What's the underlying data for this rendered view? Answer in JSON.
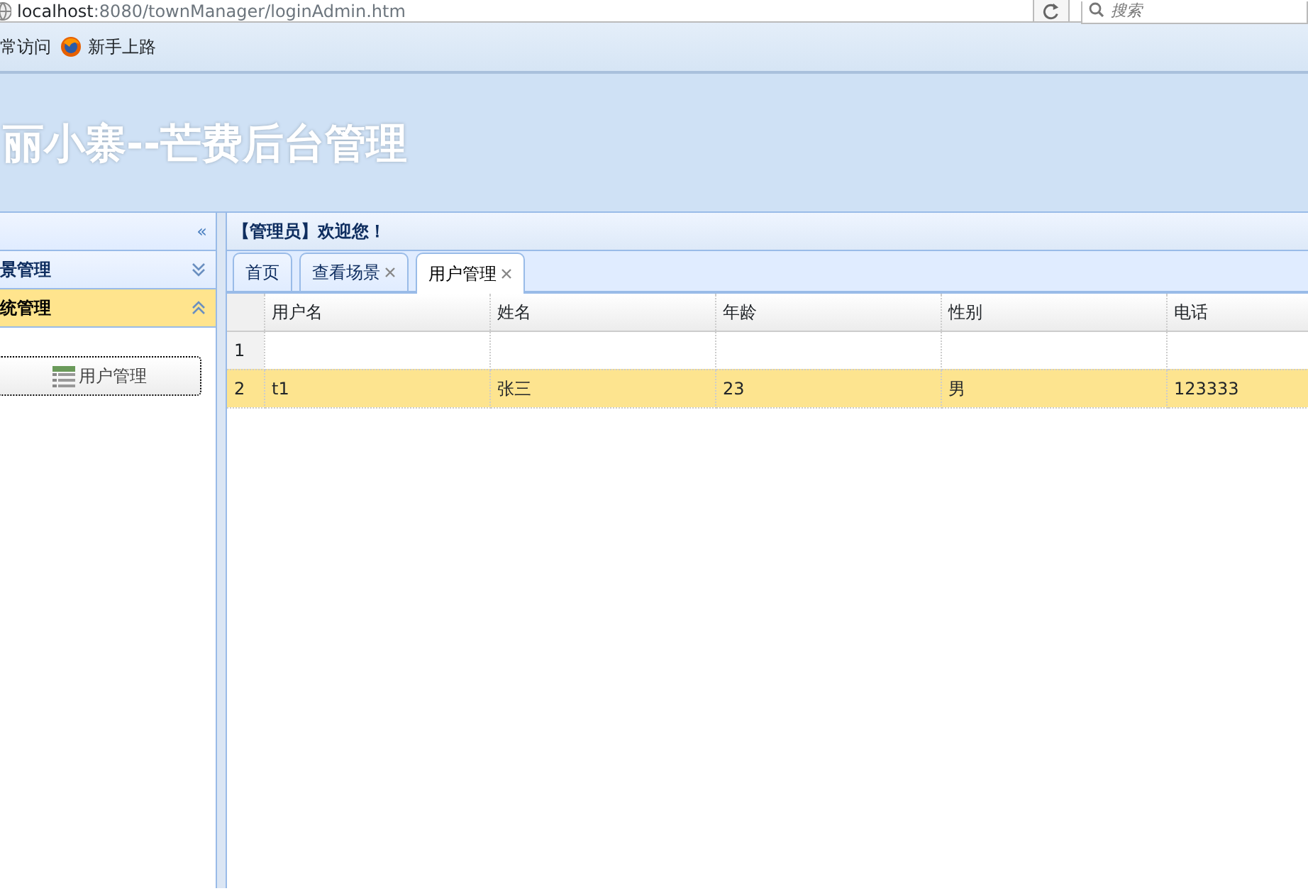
{
  "browser": {
    "url_host": "localhost",
    "url_rest": ":8080/townManager/loginAdmin.htm",
    "search_placeholder": "搜索"
  },
  "bookmarks": [
    {
      "label": "常访问",
      "kind": "plain"
    },
    {
      "label": "新手上路",
      "kind": "firefox"
    }
  ],
  "header": {
    "title": "丽小寨--芒费后台管理"
  },
  "sidebar": {
    "collapse_glyph": "«",
    "sections": [
      {
        "label": "景管理",
        "expanded": false,
        "selected": false
      },
      {
        "label": "统管理",
        "expanded": true,
        "selected": true,
        "items": [
          {
            "label": "用户管理",
            "focused": true
          }
        ]
      }
    ]
  },
  "welcome": "【管理员】欢迎您！",
  "tabs": [
    {
      "label": "首页",
      "closable": false,
      "selected": false
    },
    {
      "label": "查看场景",
      "closable": true,
      "selected": false
    },
    {
      "label": "用户管理",
      "closable": true,
      "selected": true
    }
  ],
  "table": {
    "columns": [
      "用户名",
      "姓名",
      "年龄",
      "性别",
      "电话"
    ],
    "rows": [
      {
        "number": "1",
        "cells": [
          "",
          "",
          "",
          "",
          ""
        ],
        "selected": false
      },
      {
        "number": "2",
        "cells": [
          "t1",
          "张三",
          "23",
          "男",
          "123333"
        ],
        "selected": true
      }
    ]
  }
}
